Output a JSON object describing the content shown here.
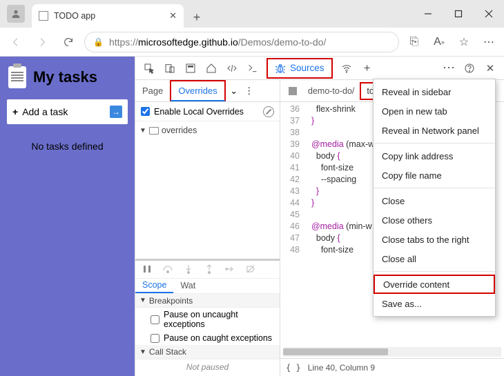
{
  "browser": {
    "tab_title": "TODO app",
    "url_host": "microsoftedge.github.io",
    "url_prefix": "https://",
    "url_path": "/Demos/demo-to-do/"
  },
  "page": {
    "title": "My tasks",
    "add_task": "Add a task",
    "empty": "No tasks defined"
  },
  "devtools": {
    "active_panel": "Sources",
    "sources_subtabs": {
      "page": "Page",
      "overrides": "Overrides"
    },
    "enable_local_overrides": "Enable Local Overrides",
    "overrides_folder": "overrides",
    "open_files": {
      "folder": "demo-to-do/",
      "css": "to-do-styles.css"
    },
    "code_lines": [
      {
        "n": 36,
        "t": "    flex-shrink"
      },
      {
        "n": 37,
        "t": "  }"
      },
      {
        "n": 38,
        "t": ""
      },
      {
        "n": 39,
        "t": "  @media (max-w"
      },
      {
        "n": 40,
        "t": "    body {"
      },
      {
        "n": 41,
        "t": "      font-size"
      },
      {
        "n": 42,
        "t": "      --spacing"
      },
      {
        "n": 43,
        "t": "    }"
      },
      {
        "n": 44,
        "t": "  }"
      },
      {
        "n": 45,
        "t": ""
      },
      {
        "n": 46,
        "t": "  @media (min-w"
      },
      {
        "n": 47,
        "t": "    body {"
      },
      {
        "n": 48,
        "t": "      font-size"
      }
    ],
    "cursor_status": "Line 40, Column 9",
    "drawer": {
      "scope_tab": "Scope",
      "watch_tab": "Wat",
      "breakpoints_header": "Breakpoints",
      "pause_uncaught": "Pause on uncaught exceptions",
      "pause_caught": "Pause on caught exceptions",
      "callstack_header": "Call Stack",
      "not_paused": "Not paused"
    }
  },
  "context_menu": {
    "items": [
      "Reveal in sidebar",
      "Open in new tab",
      "Reveal in Network panel",
      "-",
      "Copy link address",
      "Copy file name",
      "-",
      "Close",
      "Close others",
      "Close tabs to the right",
      "Close all",
      "-",
      "Override content",
      "Save as..."
    ],
    "highlight": "Override content"
  }
}
